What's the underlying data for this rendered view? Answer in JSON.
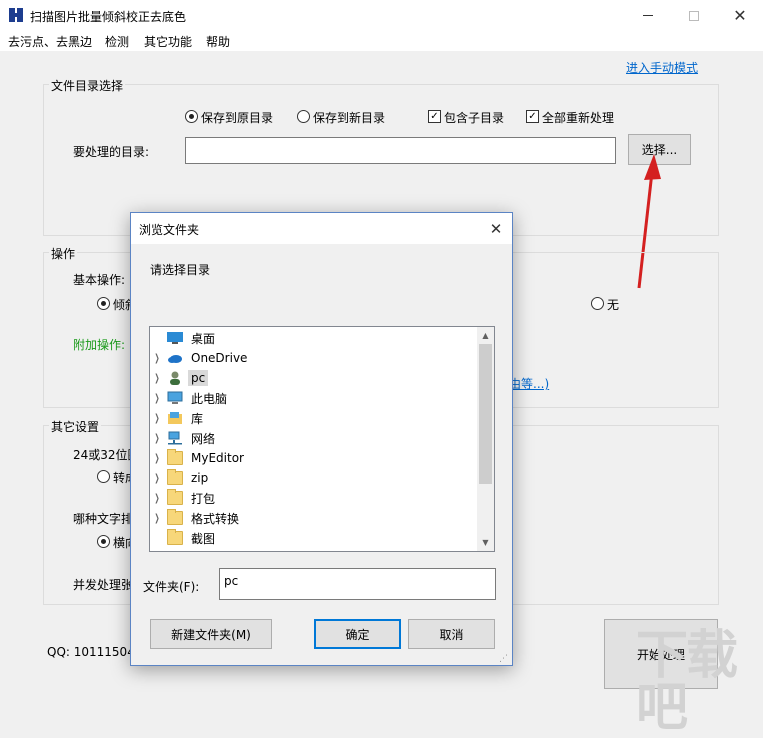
{
  "window": {
    "title": "扫描图片批量倾斜校正去底色"
  },
  "menu": [
    "去污点、去黑边",
    "检测",
    "其它功能",
    "帮助"
  ],
  "manual_mode_link": "进入手动模式",
  "file_dir_section": {
    "title": "文件目录选择",
    "save_original": "保存到原目录",
    "save_new": "保存到新目录",
    "include_subdirs": "包含子目录",
    "reprocess_all": "全部重新处理",
    "dir_label": "要处理的目录:",
    "dir_value": "",
    "select_button": "选择..."
  },
  "operation_section": {
    "title": "操作",
    "basic_label": "基本操作:",
    "basic_option_partial": "倾斜",
    "none_option": "无",
    "extra_label": "附加操作:",
    "extra_link_partial": "由等...)"
  },
  "other_settings": {
    "title": "其它设置",
    "bit_label_partial": "24或32位图",
    "convert_partial": "转成",
    "text_dir_label_partial": "哪种文字排",
    "horizontal_partial": "横向",
    "concurrency_label_partial": "并发处理张"
  },
  "qq_text": "QQ: 10111504",
  "start_button": "开始处理",
  "dialog": {
    "title": "浏览文件夹",
    "prompt": "请选择目录",
    "tree": [
      {
        "label": "桌面",
        "icon": "desktop-icon",
        "expandable": false,
        "selected": false
      },
      {
        "label": "OneDrive",
        "icon": "cloud-icon",
        "expandable": true,
        "selected": false
      },
      {
        "label": "pc",
        "icon": "user-icon",
        "expandable": true,
        "selected": true
      },
      {
        "label": "此电脑",
        "icon": "computer-icon",
        "expandable": true,
        "selected": false
      },
      {
        "label": "库",
        "icon": "library-icon",
        "expandable": true,
        "selected": false
      },
      {
        "label": "网络",
        "icon": "network-icon",
        "expandable": true,
        "selected": false
      },
      {
        "label": "MyEditor",
        "icon": "folder-icon",
        "expandable": true,
        "selected": false
      },
      {
        "label": "zip",
        "icon": "folder-icon",
        "expandable": true,
        "selected": false
      },
      {
        "label": "打包",
        "icon": "folder-icon",
        "expandable": true,
        "selected": false
      },
      {
        "label": "格式转换",
        "icon": "folder-icon",
        "expandable": true,
        "selected": false
      },
      {
        "label": "截图",
        "icon": "folder-icon",
        "expandable": false,
        "selected": false
      }
    ],
    "folder_label": "文件夹(F):",
    "folder_value": "pc",
    "new_folder_button": "新建文件夹(M)",
    "ok_button": "确定",
    "cancel_button": "取消"
  },
  "colors": {
    "accent": "#0066cc",
    "annotation_arrow": "#d42020",
    "extra_label": "#1a9a1a"
  }
}
